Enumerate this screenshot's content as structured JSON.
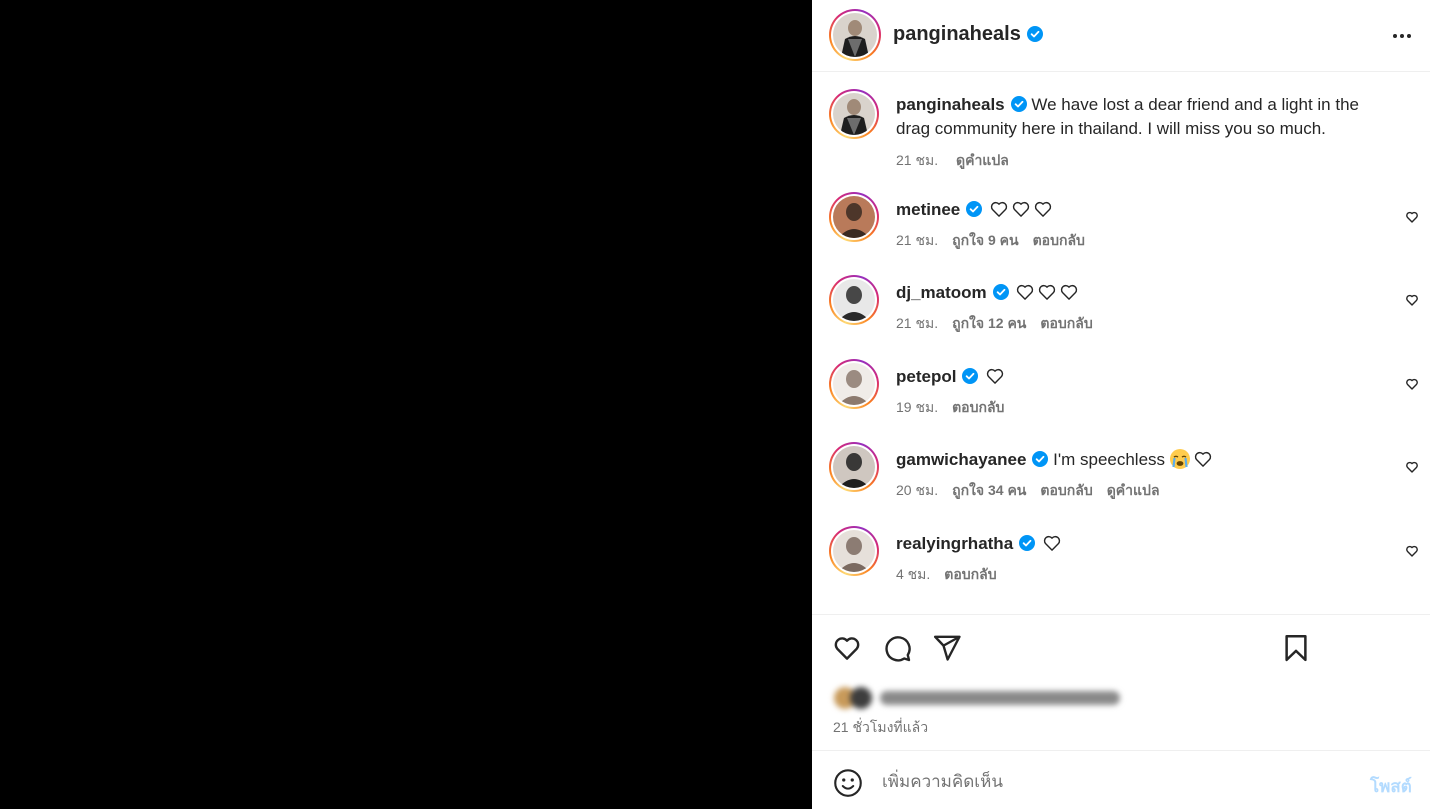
{
  "post": {
    "author": "panginaheals",
    "caption": {
      "username": "panginaheals",
      "text": "We have lost a dear friend and a light in the drag community here in thailand. I will miss you so much.",
      "time": "21 ชม.",
      "translate": "ดูคำแปล"
    },
    "comments": [
      {
        "username": "metinee",
        "text": "",
        "hearts": 3,
        "time": "21 ชม.",
        "likes": "ถูกใจ 9 คน",
        "reply": "ตอบกลับ",
        "translate": ""
      },
      {
        "username": "dj_matoom",
        "text": "",
        "hearts": 3,
        "time": "21 ชม.",
        "likes": "ถูกใจ 12 คน",
        "reply": "ตอบกลับ",
        "translate": ""
      },
      {
        "username": "petepol",
        "text": "",
        "hearts": 1,
        "time": "19 ชม.",
        "likes": "",
        "reply": "ตอบกลับ",
        "translate": ""
      },
      {
        "username": "gamwichayanee",
        "text": "I'm speechless",
        "hearts": 1,
        "time": "20 ชม.",
        "likes": "ถูกใจ 34 คน",
        "reply": "ตอบกลับ",
        "translate": "ดูคำแปล"
      },
      {
        "username": "realyingrhatha",
        "text": "",
        "hearts": 1,
        "time": "4 ชม.",
        "likes": "",
        "reply": "ตอบกลับ",
        "translate": ""
      }
    ],
    "posted_time": "21 ชั่วโมงที่แล้ว"
  },
  "compose": {
    "placeholder": "เพิ่มความคิดเห็น",
    "post_label": "โพสต์"
  },
  "colors": {
    "verified": "#0095f6",
    "post_button_disabled": "#b3dbff",
    "meta_text": "#737373"
  }
}
